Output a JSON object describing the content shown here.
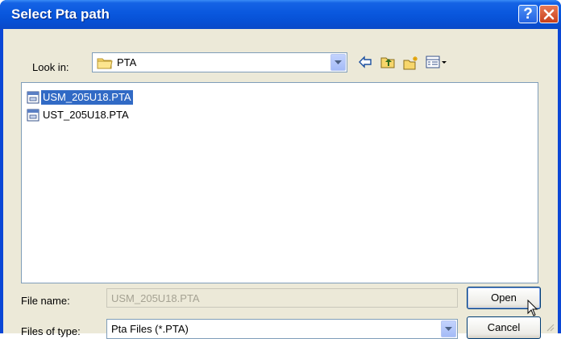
{
  "window": {
    "title": "Select Pta path"
  },
  "lookin": {
    "label": "Look in:",
    "value": "PTA"
  },
  "files": [
    {
      "name": "USM_205U18.PTA",
      "selected": true
    },
    {
      "name": "UST_205U18.PTA",
      "selected": false
    }
  ],
  "filename": {
    "label": "File name:",
    "value": "USM_205U18.PTA"
  },
  "filetype": {
    "label": "Files of type:",
    "value": "Pta Files (*.PTA)"
  },
  "buttons": {
    "open": "Open",
    "cancel": "Cancel"
  },
  "icons": {
    "help": "help-icon",
    "close": "close-icon",
    "folder": "folder-icon",
    "back": "back-arrow-icon",
    "up": "up-folder-icon",
    "new_folder": "new-folder-icon",
    "views": "views-menu-icon",
    "file": "pta-file-icon",
    "cursor": "mouse-pointer-icon"
  },
  "colors": {
    "title_bar": "#0a58de",
    "selection": "#316ac5",
    "dialog_bg": "#ece9d8"
  }
}
